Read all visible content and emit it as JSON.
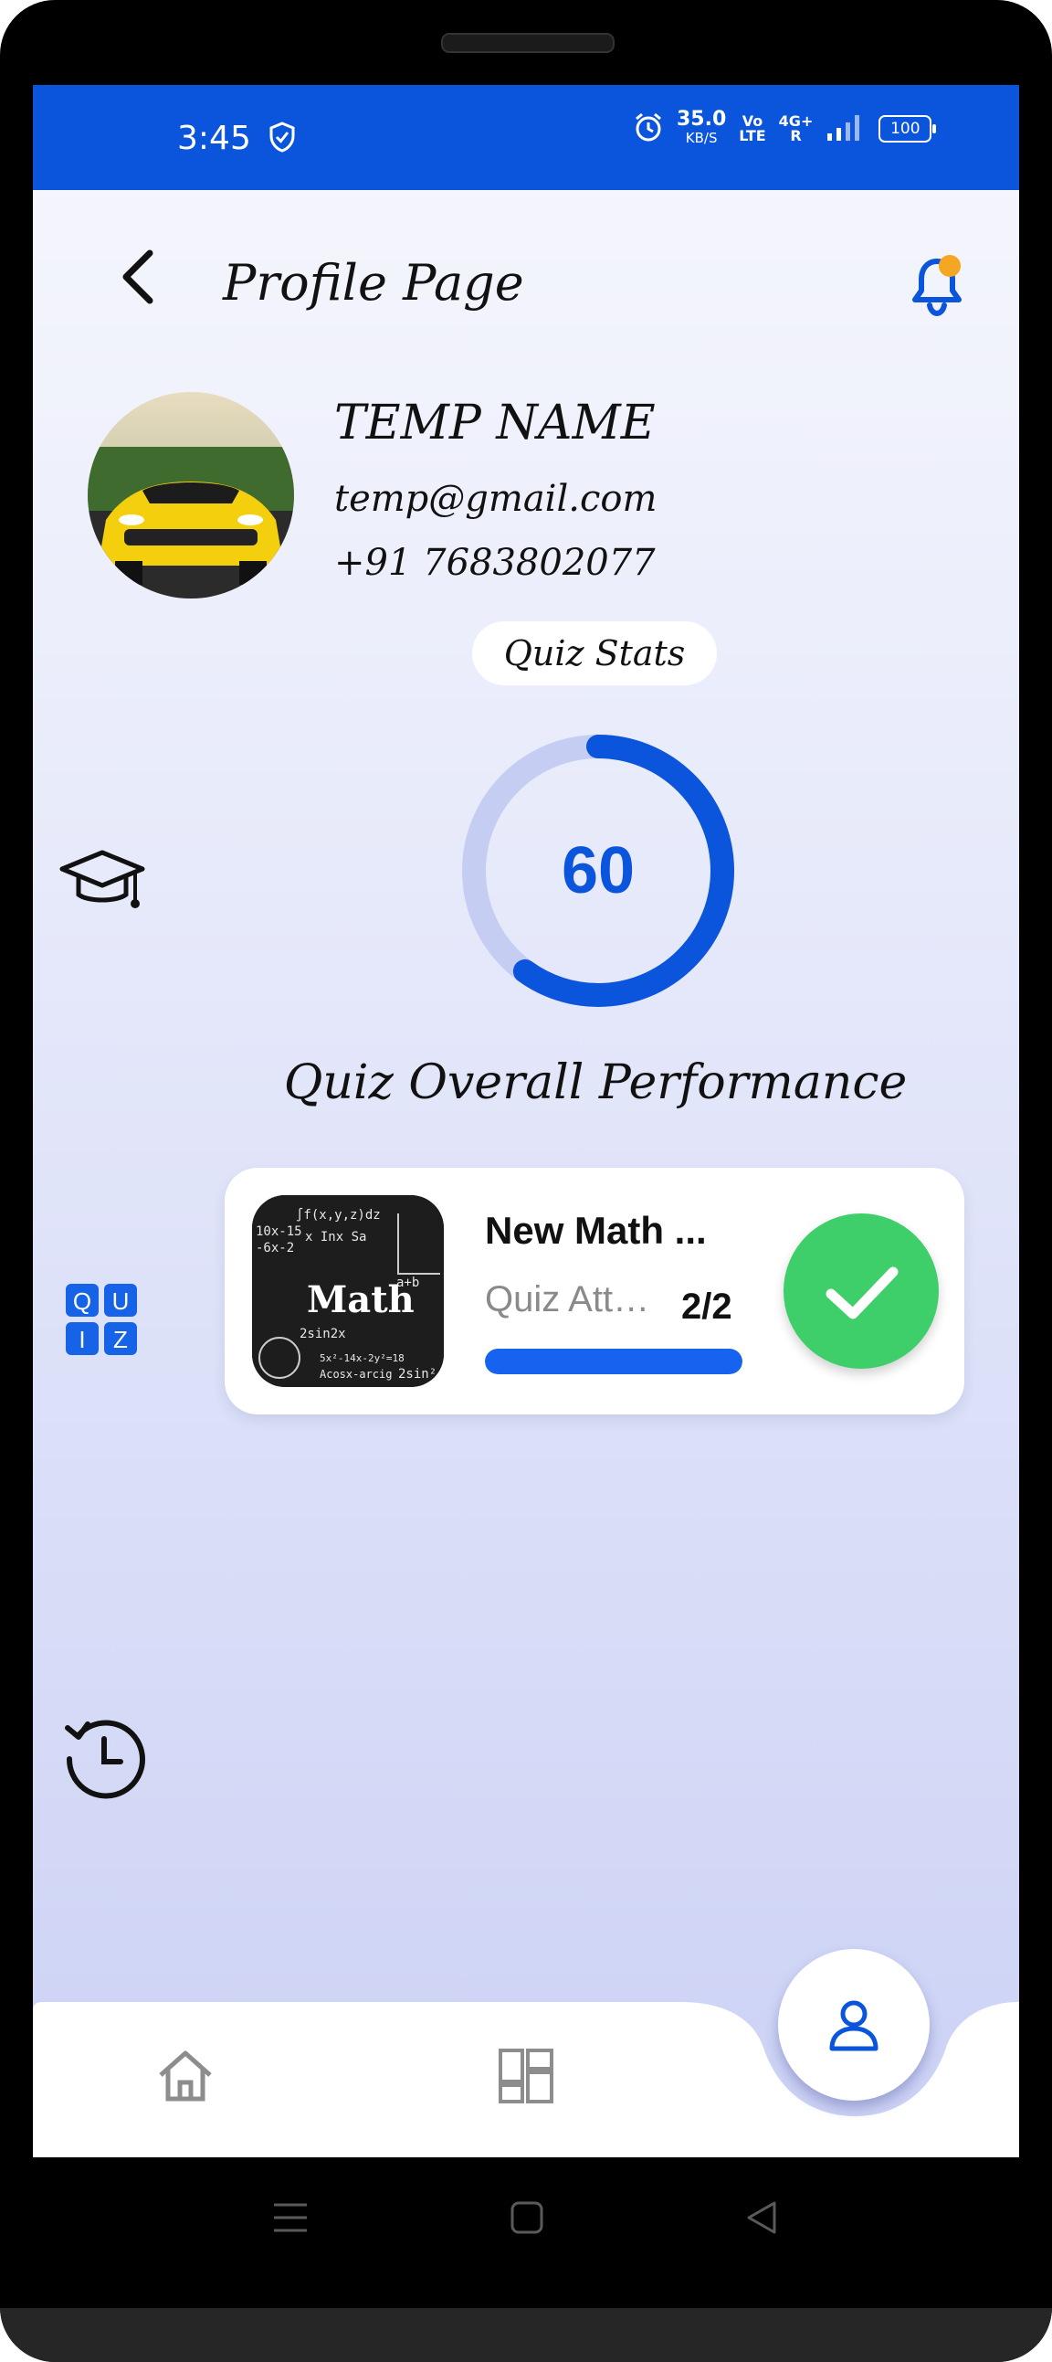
{
  "status_bar": {
    "time": "3:45",
    "net_speed": "35.0",
    "net_unit": "KB/S",
    "volte_top": "Vo",
    "volte_bottom": "LTE",
    "network": "4G+",
    "network_sub": "R",
    "battery": "100"
  },
  "header": {
    "title": "Profile Page"
  },
  "profile": {
    "name": "TEMP NAME",
    "email": "temp@gmail.com",
    "phone": "+91 7683802077"
  },
  "stats": {
    "chip_label": "Quiz Stats",
    "ring_value": "60",
    "ring_fraction": 0.6,
    "performance_label": "Quiz Overall Performance"
  },
  "quiz_card": {
    "title": "New Math ...",
    "status": "Quiz Attempted",
    "count": "2/2",
    "progress": 1.0,
    "thumb_text": "Math",
    "thumb_lines": [
      "∫f(x,y,z)dz",
      "x  Inx  Sa",
      "10x-15",
      "-6x-2",
      "2sin2x",
      "a+b",
      "5x²-14x-2y²=18",
      "Acosx-arcig",
      "2sin²"
    ]
  },
  "side_icons": {
    "quiz_letters": [
      "Q",
      "U",
      "I",
      "Z"
    ]
  },
  "colors": {
    "accent": "#0a55dc",
    "success": "#3ecf6a",
    "notification_dot": "#f5a623"
  },
  "icons": {
    "back": "back-arrow-icon",
    "bell": "bell-icon",
    "graduation": "graduation-cap-icon",
    "quiz": "quiz-icon",
    "history": "history-icon",
    "home": "home-icon",
    "dashboard": "dashboard-icon",
    "profile": "profile-icon",
    "check": "check-icon"
  }
}
